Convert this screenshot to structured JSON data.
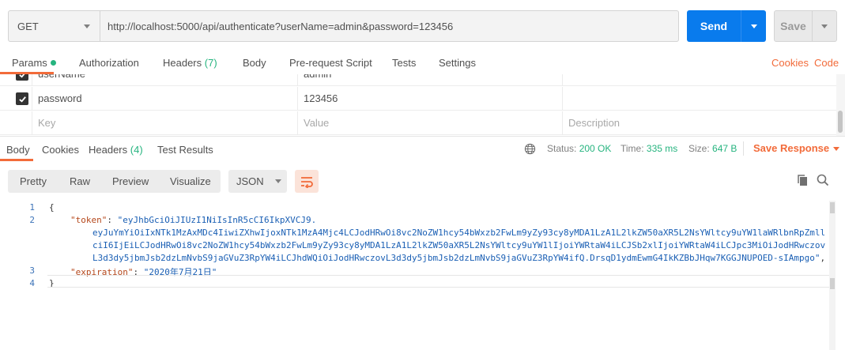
{
  "request": {
    "method": "GET",
    "url": "http://localhost:5000/api/authenticate?userName=admin&password=123456",
    "send_label": "Send",
    "save_label": "Save"
  },
  "request_tabs": {
    "params": "Params",
    "authorization": "Authorization",
    "headers": "Headers",
    "headers_count": "(7)",
    "body": "Body",
    "pre_request": "Pre-request Script",
    "tests": "Tests",
    "settings": "Settings",
    "cookies": "Cookies",
    "code": "Code"
  },
  "params": {
    "rows": [
      {
        "key": "userName",
        "value": "admin",
        "checked": true
      },
      {
        "key": "password",
        "value": "123456",
        "checked": true
      }
    ],
    "placeholder_key": "Key",
    "placeholder_value": "Value",
    "placeholder_description": "Description"
  },
  "response_tabs": {
    "body": "Body",
    "cookies": "Cookies",
    "headers": "Headers",
    "headers_count": "(4)",
    "test_results": "Test Results"
  },
  "status": {
    "status_label": "Status:",
    "status_value": "200 OK",
    "time_label": "Time:",
    "time_value": "335 ms",
    "size_label": "Size:",
    "size_value": "647 B",
    "save_response": "Save Response"
  },
  "toolbar": {
    "pretty": "Pretty",
    "raw": "Raw",
    "preview": "Preview",
    "visualize": "Visualize",
    "format": "JSON"
  },
  "editor": {
    "line_numbers": [
      "1",
      "2",
      "3",
      "4"
    ],
    "open_brace": "{",
    "close_brace": "}",
    "token_key": "\"token\"",
    "token_lines": [
      "\"eyJhbGciOiJIUzI1NiIsInR5cCI6IkpXVCJ9.",
      "eyJuYmYiOiIxNTk1MzAxMDc4IiwiZXhwIjoxNTk1MzA4Mjc4LCJodHRwOi8vc2NoZW1hcy54bWxzb2FwLm9yZy93cy8yMDA1LzA1L2lkZW50aXR5L2NsYWltcy9uYW1laWRlbnRpZmll",
      "ciI6IjEiLCJodHRwOi8vc2NoZW1hcy54bWxzb2FwLm9yZy93cy8yMDA1LzA1L2lkZW50aXR5L2NsYWltcy9uYW1lIjoiYWRtaW4iLCJSb2xlIjoiYWRtaW4iLCJpc3MiOiJodHRwczov",
      "L3d3dy5jbmJsb2dzLmNvbS9jaGVuZ3RpYW4iLCJhdWQiOiJodHRwczovL3d3dy5jbmJsb2dzLmNvbS9jaGVuZ3RpYW4ifQ.DrsqD1ydmEwmG4IkKZBbJHqw7KGGJNUPOED-sIAmpgo\""
    ],
    "expiration_key": "\"expiration\"",
    "expiration_value": "\"2020年7月21日\""
  }
}
